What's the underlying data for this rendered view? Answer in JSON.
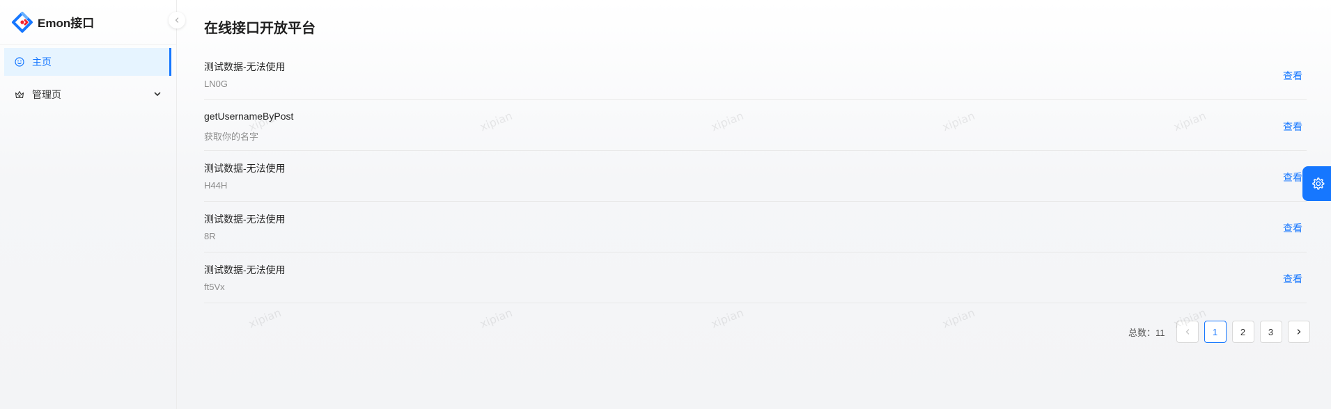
{
  "app": {
    "title": "Emon接口"
  },
  "sidebar": {
    "items": [
      {
        "label": "主页",
        "icon": "smile-icon",
        "active": true
      },
      {
        "label": "管理页",
        "icon": "crown-icon",
        "expandable": true
      }
    ]
  },
  "main": {
    "title": "在线接口开放平台",
    "rows": [
      {
        "title": "测试数据-无法使用",
        "desc": "LN0G",
        "action": "查看"
      },
      {
        "title": "getUsernameByPost",
        "desc": "获取你的名字",
        "action": "查看"
      },
      {
        "title": "测试数据-无法使用",
        "desc": "H44H",
        "action": "查看"
      },
      {
        "title": "测试数据-无法使用",
        "desc": "8R",
        "action": "查看"
      },
      {
        "title": "测试数据-无法使用",
        "desc": "ft5Vx",
        "action": "查看"
      }
    ],
    "pagination": {
      "total_label": "总数：11",
      "pages": [
        "1",
        "2",
        "3"
      ],
      "current": "1"
    }
  },
  "watermark": "xipian",
  "colors": {
    "accent": "#1677ff",
    "active_bg": "#e6f4ff"
  }
}
